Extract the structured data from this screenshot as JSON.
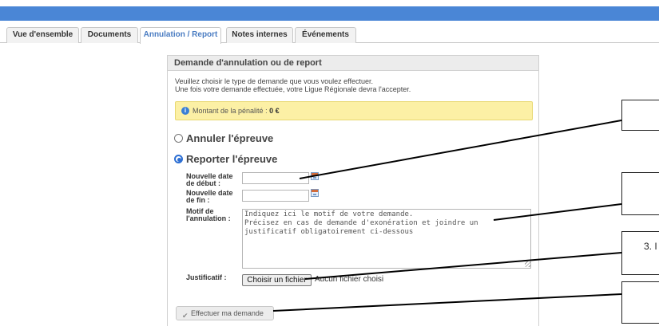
{
  "tabs": [
    {
      "label": "Vue d'ensemble",
      "active": false
    },
    {
      "label": "Documents",
      "active": false
    },
    {
      "label": "Annulation / Report",
      "active": true
    },
    {
      "label": "Notes internes",
      "active": false
    },
    {
      "label": "Événements",
      "active": false
    }
  ],
  "panel": {
    "title": "Demande d'annulation ou de report",
    "intro_line1": "Veuillez choisir le type de demande que vous voulez effectuer.",
    "intro_line2": "Une fois votre demande effectuée, votre Ligue Régionale devra l'accepter."
  },
  "alert": {
    "icon": "info-icon",
    "label": "Montant de la pénalité : ",
    "value": "0 €"
  },
  "options": {
    "cancel_label": "Annuler l'épreuve",
    "postpone_label": "Reporter l'épreuve",
    "selected": "postpone"
  },
  "form": {
    "start_label_line1": "Nouvelle date",
    "start_label_line2": "de début :",
    "end_label_line1": "Nouvelle date",
    "end_label_line2": "de fin :",
    "start_value": "",
    "end_value": "",
    "motif_label_line1": "Motif de",
    "motif_label_line2": "l'annulation :",
    "motif_placeholder": "Indiquez ici le motif de votre demande.\nPrécisez en cas de demande d'exonération et joindre un\njustificatif obligatoirement ci-dessous",
    "justificatif_label": "Justificatif :",
    "file_button_label": "Choisir un fichier",
    "file_status": "Aucun fichier choisi",
    "submit_label": "Effectuer ma demande"
  },
  "callouts": [
    {
      "label": ""
    },
    {
      "label": ""
    },
    {
      "label": "3. I"
    },
    {
      "label": ""
    }
  ],
  "colors": {
    "topbar": "#4a86d6",
    "active_tab_text": "#4a7cc2",
    "alert_bg": "#fcf0a5",
    "radio_selected": "#2d6fd3"
  }
}
